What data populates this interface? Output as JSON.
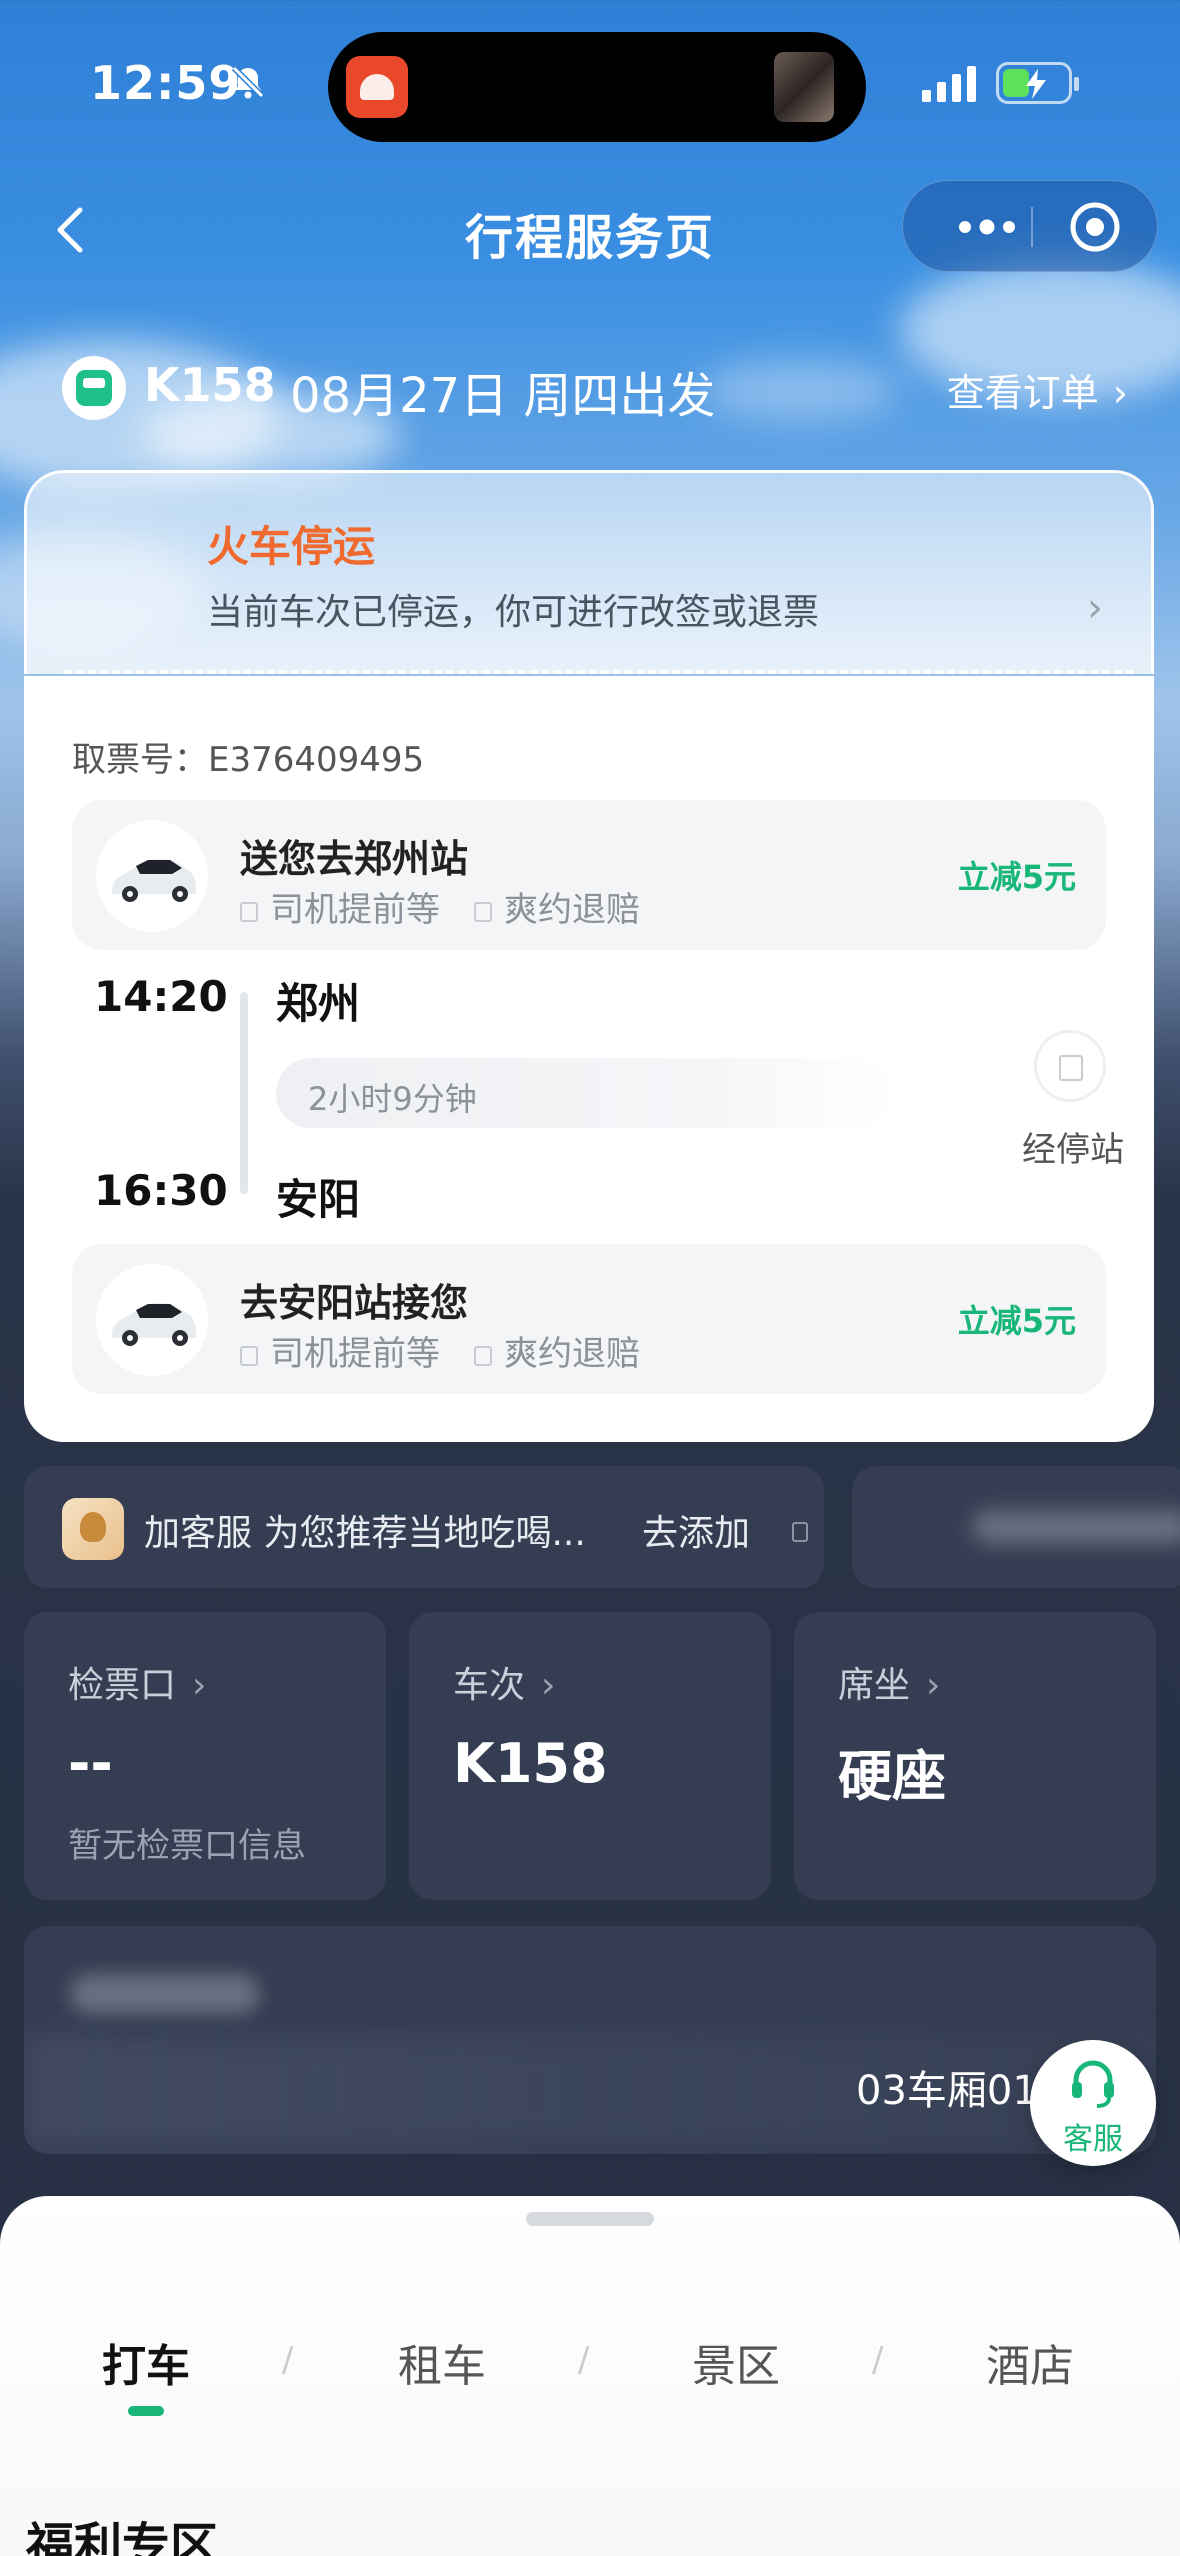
{
  "status_bar": {
    "time": "12:59"
  },
  "nav": {
    "title": "行程服务页"
  },
  "train_header": {
    "train_no": "K158",
    "date": "08月27日 周四出发",
    "view_order": "查看订单"
  },
  "notice": {
    "title": "火车停运",
    "desc": "当前车次已停运，你可进行改签或退票"
  },
  "ticket": {
    "pickup_no": "取票号：E376409495"
  },
  "taxi_top": {
    "title": "送您去郑州站",
    "tag1": "司机提前等",
    "tag2": "爽约退赔",
    "promo": "立减5元"
  },
  "journey": {
    "depart_time": "14:20",
    "depart_station": "郑州",
    "duration": "2小时9分钟",
    "arrive_time": "16:30",
    "arrive_station": "安阳",
    "stops_label": "经停站"
  },
  "taxi_bottom": {
    "title": "去安阳站接您",
    "tag1": "司机提前等",
    "tag2": "爽约退赔",
    "promo": "立减5元"
  },
  "service": {
    "text": "加客服 为您推荐当地吃喝...",
    "action": "去添加"
  },
  "info_cards": [
    {
      "label": "检票口",
      "value": "--",
      "sub": "暂无检票口信息"
    },
    {
      "label": "车次",
      "value": "K158",
      "sub": ""
    },
    {
      "label": "席坐",
      "value": "硬座",
      "sub": ""
    }
  ],
  "seat": {
    "text": "03车厢01"
  },
  "customer_service": {
    "label": "客服"
  },
  "tabs": [
    {
      "label": "打车"
    },
    {
      "label": "租车"
    },
    {
      "label": "景区"
    },
    {
      "label": "酒店"
    }
  ],
  "section": {
    "title": "福利专区"
  },
  "colors": {
    "accent_green": "#19b67a",
    "alert_orange": "#f06a2f",
    "card_dark": "#343d52"
  }
}
